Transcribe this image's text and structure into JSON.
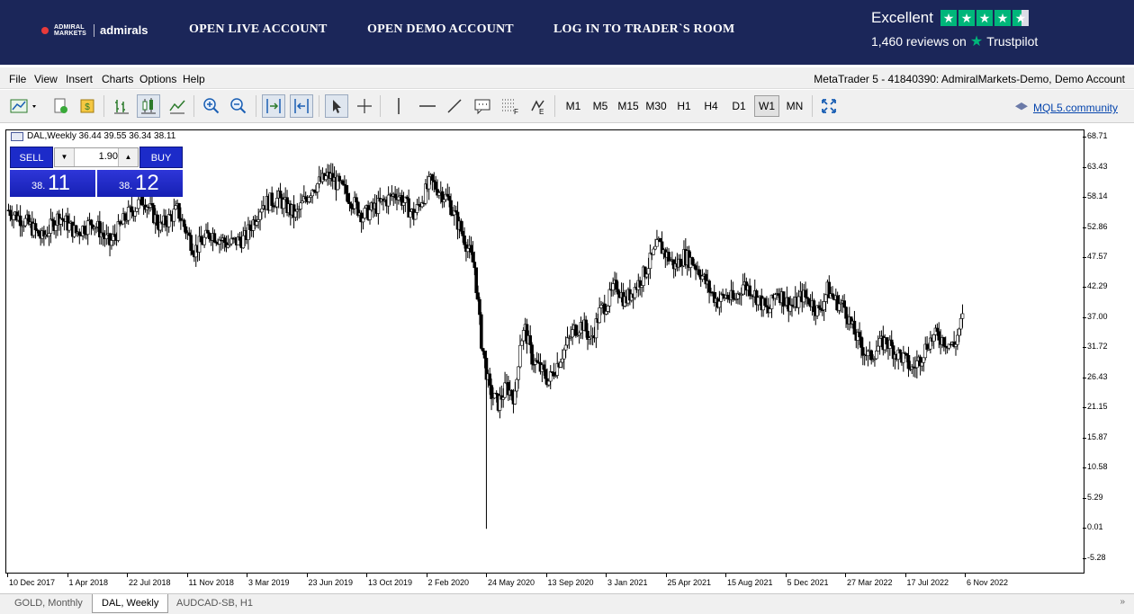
{
  "banner": {
    "logo_small": "ADMIRAL MARKETS",
    "logo_big": "admirals",
    "links": [
      "OPEN LIVE ACCOUNT",
      "OPEN DEMO ACCOUNT",
      "LOG IN TO TRADER`S ROOM"
    ],
    "trustpilot": {
      "rating": "Excellent",
      "reviews": "1,460 reviews on",
      "brand": "Trustpilot"
    }
  },
  "menu": {
    "items": [
      "File",
      "View",
      "Insert",
      "Charts",
      "Options",
      "Help"
    ],
    "title": "MetaTrader 5 - 41840390: AdmiralMarkets-Demo, Demo Account"
  },
  "toolbar": {
    "timeframes": [
      "M1",
      "M5",
      "M15",
      "M30",
      "H1",
      "H4",
      "D1",
      "W1",
      "MN"
    ],
    "active_timeframe": "W1",
    "community": "MQL5.community"
  },
  "chart": {
    "title": "DAL,Weekly  36.44 39.55 36.34 38.11",
    "trade_panel": {
      "sell_label": "SELL",
      "buy_label": "BUY",
      "volume": "1.90",
      "sell_price_small": "38.",
      "sell_price_big": "11",
      "buy_price_small": "38.",
      "buy_price_big": "12"
    }
  },
  "chart_data": {
    "type": "candlestick",
    "symbol": "DAL",
    "timeframe": "Weekly",
    "y_ticks": [
      "68.71",
      "63.43",
      "58.14",
      "52.86",
      "47.57",
      "42.29",
      "37.00",
      "31.72",
      "26.43",
      "21.15",
      "15.87",
      "10.58",
      "5.29",
      "0.01",
      "-5.28"
    ],
    "x_ticks": [
      "10 Dec 2017",
      "1 Apr 2018",
      "22 Jul 2018",
      "11 Nov 2018",
      "3 Mar 2019",
      "23 Jun 2019",
      "13 Oct 2019",
      "2 Feb 2020",
      "24 May 2020",
      "13 Sep 2020",
      "3 Jan 2021",
      "25 Apr 2021",
      "15 Aug 2021",
      "5 Dec 2021",
      "27 Mar 2022",
      "17 Jul 2022",
      "6 Nov 2022"
    ],
    "ylim": [
      -8,
      70
    ],
    "close_path": [
      [
        0,
        56
      ],
      [
        10,
        54
      ],
      [
        20,
        51
      ],
      [
        30,
        55
      ],
      [
        40,
        52
      ],
      [
        50,
        54
      ],
      [
        60,
        50
      ],
      [
        70,
        55
      ],
      [
        80,
        58
      ],
      [
        90,
        53
      ],
      [
        100,
        56
      ],
      [
        110,
        49
      ],
      [
        120,
        52
      ],
      [
        130,
        50
      ],
      [
        140,
        51
      ],
      [
        150,
        57
      ],
      [
        160,
        58
      ],
      [
        170,
        55
      ],
      [
        180,
        60
      ],
      [
        190,
        62
      ],
      [
        200,
        59
      ],
      [
        210,
        55
      ],
      [
        220,
        57
      ],
      [
        230,
        59
      ],
      [
        240,
        55
      ],
      [
        250,
        61
      ],
      [
        260,
        58
      ],
      [
        270,
        51
      ],
      [
        276,
        46
      ],
      [
        280,
        33
      ],
      [
        285,
        24
      ],
      [
        290,
        22
      ],
      [
        295,
        25
      ],
      [
        300,
        23
      ],
      [
        303,
        33
      ],
      [
        306,
        35
      ],
      [
        310,
        30
      ],
      [
        315,
        28
      ],
      [
        320,
        26
      ],
      [
        325,
        29
      ],
      [
        330,
        32
      ],
      [
        335,
        35
      ],
      [
        340,
        36
      ],
      [
        345,
        33
      ],
      [
        350,
        38
      ],
      [
        355,
        40
      ],
      [
        360,
        43
      ],
      [
        365,
        40
      ],
      [
        370,
        42
      ],
      [
        375,
        44
      ],
      [
        380,
        47
      ],
      [
        385,
        50
      ],
      [
        390,
        48
      ],
      [
        395,
        46
      ],
      [
        400,
        48
      ],
      [
        405,
        47
      ],
      [
        410,
        45
      ],
      [
        415,
        42
      ],
      [
        420,
        40
      ],
      [
        425,
        41
      ],
      [
        430,
        40
      ],
      [
        435,
        43
      ],
      [
        440,
        42
      ],
      [
        445,
        40
      ],
      [
        450,
        38
      ],
      [
        455,
        42
      ],
      [
        460,
        40
      ],
      [
        465,
        39
      ],
      [
        470,
        41
      ],
      [
        475,
        40
      ],
      [
        480,
        38
      ],
      [
        485,
        42
      ],
      [
        490,
        40
      ],
      [
        495,
        39
      ],
      [
        500,
        35
      ],
      [
        505,
        32
      ],
      [
        510,
        30
      ],
      [
        515,
        32
      ],
      [
        520,
        33
      ],
      [
        525,
        31
      ],
      [
        530,
        30
      ],
      [
        535,
        28
      ],
      [
        540,
        30
      ],
      [
        545,
        33
      ],
      [
        550,
        34
      ],
      [
        555,
        33
      ],
      [
        560,
        32
      ],
      [
        565,
        37
      ]
    ],
    "spike_low": 0.01
  }
}
